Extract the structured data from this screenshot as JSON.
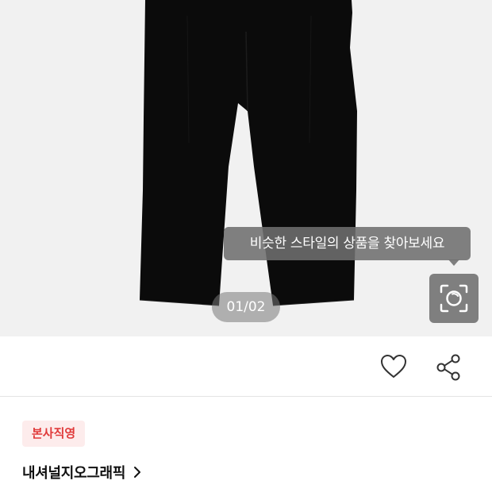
{
  "gallery": {
    "tooltip_text": "비슷한 스타일의 상품을 찾아보세요",
    "page_indicator": "01/02",
    "current_page": 1,
    "total_pages": 2
  },
  "icons": {
    "camera": "camera-search-icon",
    "like": "heart-icon",
    "share": "share-icon",
    "brand_chevron": "chevron-right-icon"
  },
  "product": {
    "badge": "본사직영",
    "brand": "내셔널지오그래픽"
  },
  "colors": {
    "badge_text": "#e03a3a",
    "badge_bg": "#fdecec",
    "image_bg": "#f1f1f1",
    "product_color": "#0b0b0b"
  }
}
